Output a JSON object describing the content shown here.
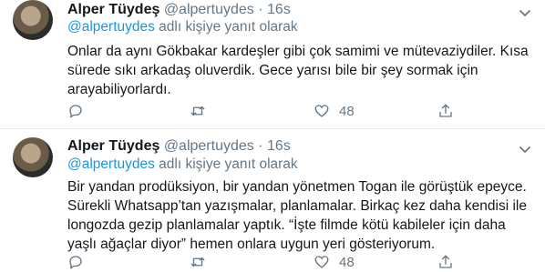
{
  "tweets": [
    {
      "display_name": "Alper Tüydeş",
      "handle": "@alpertuydes",
      "separator": "·",
      "time": "16s",
      "replying_mention": "@alpertuydes",
      "replying_suffix": " adlı kişiye yanıt olarak",
      "lines": [
        "Onlar da aynı Gökbakar kardeşler gibi çok samimi ve mütevaziydiler. Kısa",
        "sürede sıkı arkadaş oluverdik. Gece yarısı bile bir şey sormak için",
        "arayabiliyorlardı."
      ],
      "like_count": "48"
    },
    {
      "display_name": "Alper Tüydeş",
      "handle": "@alpertuydes",
      "separator": "·",
      "time": "16s",
      "replying_mention": "@alpertuydes",
      "replying_suffix": " adlı kişiye yanıt olarak",
      "lines": [
        "Bir yandan prodüksiyon, bir yandan yönetmen Togan ile görüştük epeyce.",
        "Sürekli Whatsapp’tan yazışmalar, planlamalar. Birkaç kez daha kendisi ile",
        "longozda gezip planlamalar yaptık. “İşte filmde kötü kabileler için daha",
        "yaşlı ağaçlar diyor” hemen onlara uygun yeri gösteriyorum."
      ],
      "like_count": "48"
    }
  ],
  "icons": {
    "reply": "reply-icon",
    "retweet": "retweet-icon",
    "like": "heart-icon",
    "share": "share-icon",
    "more": "chevron-down-icon"
  },
  "colors": {
    "text": "#14171a",
    "secondary": "#657786",
    "link": "#1b95e0",
    "divider": "#e6ecf0"
  }
}
